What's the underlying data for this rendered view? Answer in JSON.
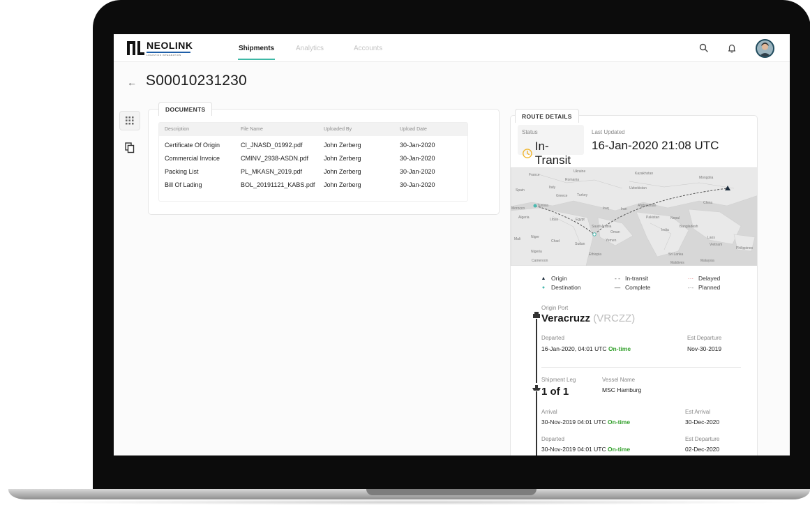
{
  "brand": {
    "name": "NEOLINK",
    "tagline": "LOGISTICS INTEGRATION"
  },
  "nav": {
    "tabs": [
      {
        "label": "Shipments",
        "active": true
      },
      {
        "label": "Analytics",
        "active": false
      },
      {
        "label": "Accounts",
        "active": false
      }
    ]
  },
  "page": {
    "back": "←",
    "title": "S00010231230"
  },
  "documents": {
    "tab_label": "DOCUMENTS",
    "columns": [
      "Description",
      "File Name",
      "Uploaded By",
      "Upload Date"
    ],
    "rows": [
      [
        "Certificate Of Origin",
        "CI_JNASD_01992.pdf",
        "John Zerberg",
        "30-Jan-2020"
      ],
      [
        "Commercial Invoice",
        "CMINV_2938-ASDN.pdf",
        "John Zerberg",
        "30-Jan-2020"
      ],
      [
        "Packing List",
        "PL_MKASN_2019.pdf",
        "John Zerberg",
        "30-Jan-2020"
      ],
      [
        "Bill Of Lading",
        "BOL_20191121_KABS.pdf",
        "John Zerberg",
        "30-Jan-2020"
      ]
    ]
  },
  "route": {
    "tab_label": "ROUTE DETAILS",
    "status_label": "Status",
    "status_value": "In-Transit",
    "updated_label": "Last Updated",
    "updated_value": "16-Jan-2020 21:08 UTC",
    "map_labels": [
      "France",
      "Ukraine",
      "Kazakhstan",
      "Mongolia",
      "Romania",
      "Spain",
      "Italy",
      "Uzbekistan",
      "Greece",
      "Turkey",
      "Tunisia",
      "Iraq",
      "Iran",
      "Afghanistan",
      "China",
      "Morocco",
      "Algeria",
      "Libya",
      "Egypt",
      "Pakistan",
      "Nepal",
      "Saudi Arabia",
      "Oman",
      "India",
      "Bangladesh",
      "Mali",
      "Niger",
      "Chad",
      "Sudan",
      "Yemen",
      "Laos",
      "Nigeria",
      "Vietnam",
      "Philippines",
      "Ethiopia",
      "Cameroon",
      "Sri Lanka",
      "Maldives",
      "Malaysia"
    ],
    "legend": [
      {
        "symbol": "▲",
        "label": "Origin"
      },
      {
        "symbol": "- -",
        "label": "In-transit"
      },
      {
        "symbol": "···",
        "label": "Delayed"
      },
      {
        "symbol": "●",
        "label": "Destination"
      },
      {
        "symbol": "—",
        "label": "Complete"
      },
      {
        "symbol": "-·-",
        "label": "Planned"
      }
    ],
    "origin": {
      "label": "Origin Port",
      "name": "Veracruzz",
      "code": "(VRCZZ)",
      "departed_label": "Departed",
      "departed_value": "16-Jan-2020, 04:01 UTC",
      "departed_status": "On-time",
      "est_departure_label": "Est Departure",
      "est_departure_value": "Nov-30-2019"
    },
    "leg": {
      "label": "Shipment Leg",
      "value": "1 of 1",
      "vessel_label": "Vessel Name",
      "vessel_value": "MSC Hamburg",
      "arrival_label": "Arrival",
      "arrival_value": "30-Nov-2019 04:01 UTC",
      "arrival_status": "On-time",
      "est_arrival_label": "Est Arrival",
      "est_arrival_value": "30-Dec-2020",
      "departed_label": "Departed",
      "departed_value": "30-Nov-2019 04:01 UTC",
      "departed_status": "On-time",
      "est_departure_label": "Est Departure",
      "est_departure_value": "02-Dec-2020"
    }
  },
  "icons": {
    "search": "search-icon",
    "bell": "bell-icon",
    "grid": "grid-icon",
    "copy": "copy-icon",
    "clock": "clock-icon"
  },
  "colors": {
    "accent": "#3eb8a6",
    "brand_blue": "#1f5fa8",
    "ontime": "#33a02c",
    "status_clock": "#f0b429",
    "origin_marker": "#1a2a3a",
    "destination_marker": "#4ab9b0"
  }
}
